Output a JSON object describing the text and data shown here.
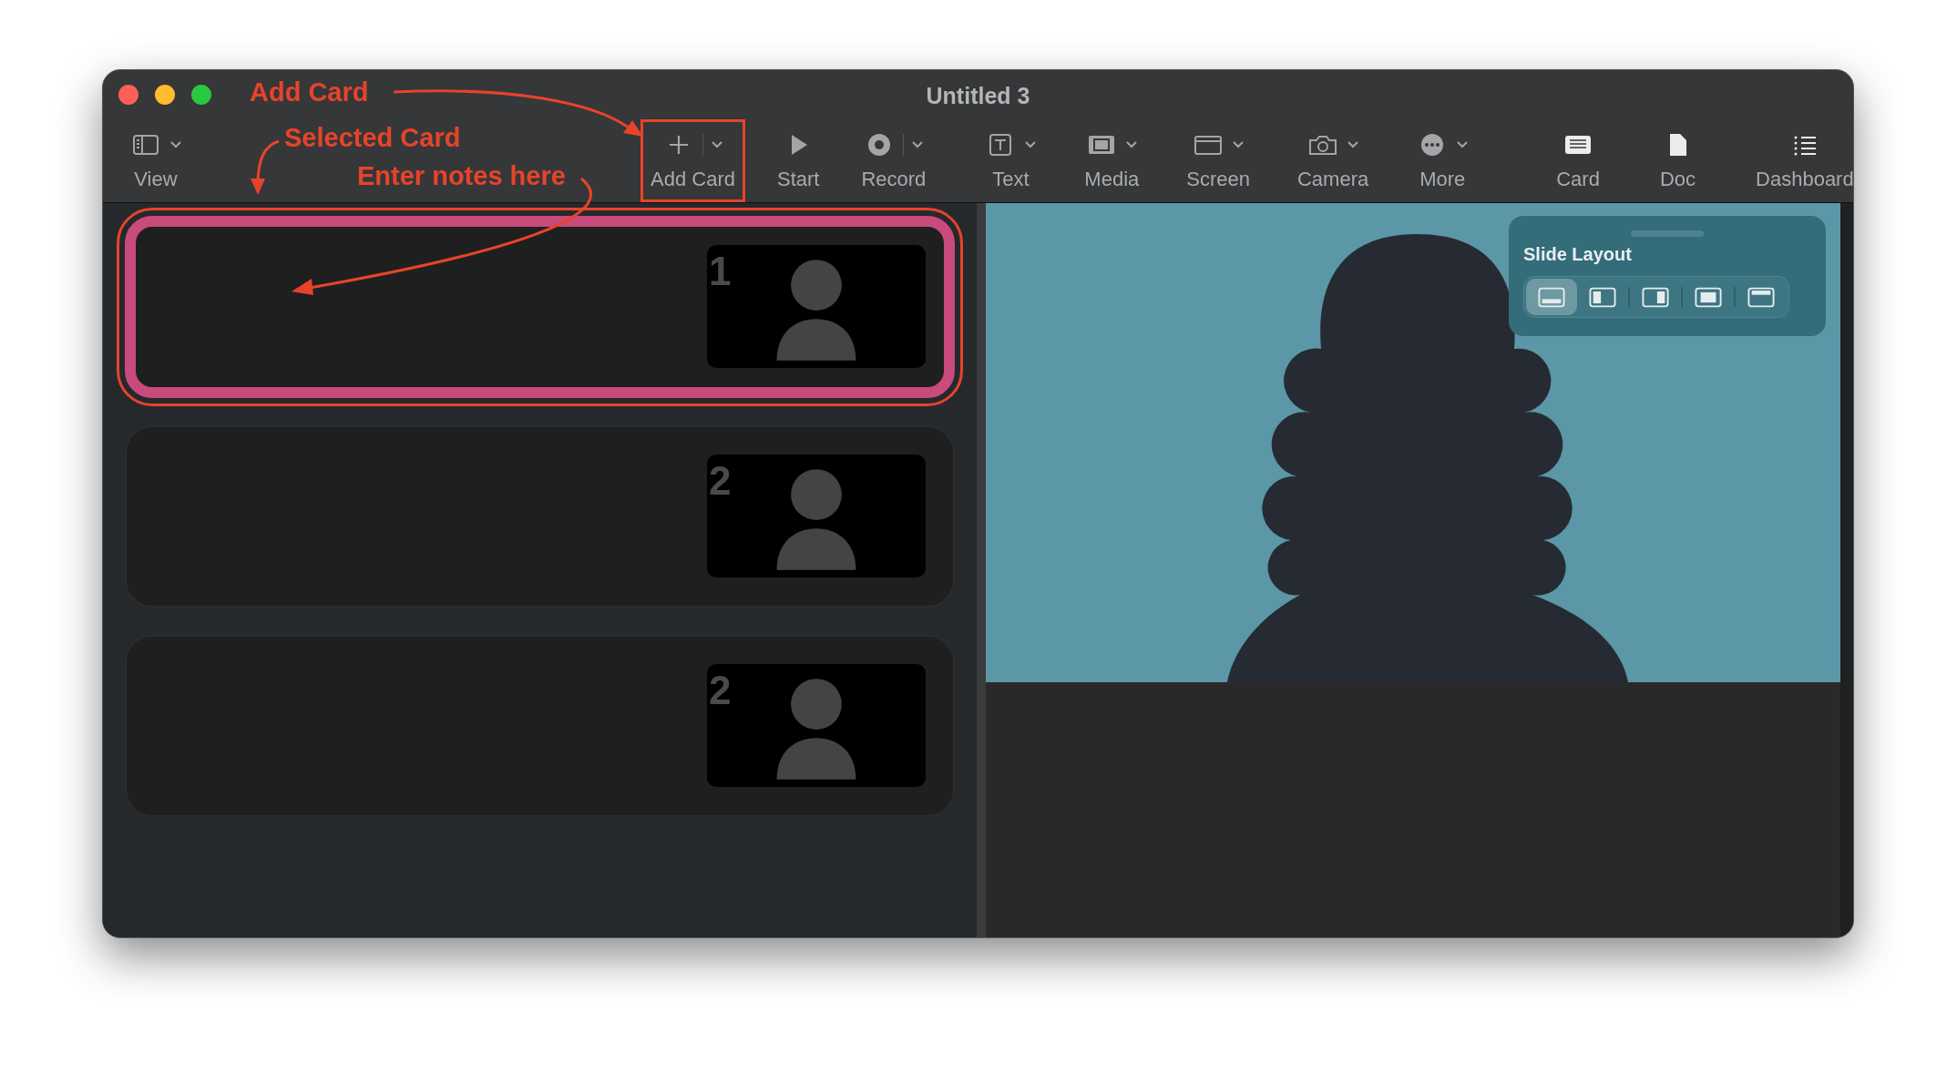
{
  "window": {
    "title": "Untitled 3"
  },
  "toolbar": [
    {
      "label": "View",
      "dropdown": true,
      "highlighted": false
    },
    {
      "label": "Add Card",
      "dropdown": true,
      "highlighted": true
    },
    {
      "label": "Start",
      "dropdown": false,
      "highlighted": false
    },
    {
      "label": "Record",
      "dropdown": true,
      "highlighted": false
    },
    {
      "label": "Text",
      "dropdown": true,
      "highlighted": false
    },
    {
      "label": "Media",
      "dropdown": true,
      "highlighted": false
    },
    {
      "label": "Screen",
      "dropdown": true,
      "highlighted": false
    },
    {
      "label": "Camera",
      "dropdown": true,
      "highlighted": false
    },
    {
      "label": "More",
      "dropdown": true,
      "highlighted": false
    },
    {
      "label": "Card",
      "dropdown": false,
      "highlighted": false
    },
    {
      "label": "Doc",
      "dropdown": false,
      "highlighted": false
    },
    {
      "label": "Dashboard",
      "dropdown": false,
      "highlighted": false
    }
  ],
  "cards": [
    {
      "number": "1",
      "selected": true,
      "highlighted": true
    },
    {
      "number": "2",
      "selected": false,
      "highlighted": false
    },
    {
      "number": "2",
      "selected": false,
      "highlighted": false
    }
  ],
  "slide_layout": {
    "title": "Slide Layout",
    "options": [
      {
        "selected": true
      },
      {
        "selected": false
      },
      {
        "selected": false
      },
      {
        "selected": false
      },
      {
        "selected": false
      }
    ]
  },
  "annotations": [
    {
      "text": "Add Card"
    },
    {
      "text": "Selected Card"
    },
    {
      "text": "Enter notes here"
    }
  ]
}
